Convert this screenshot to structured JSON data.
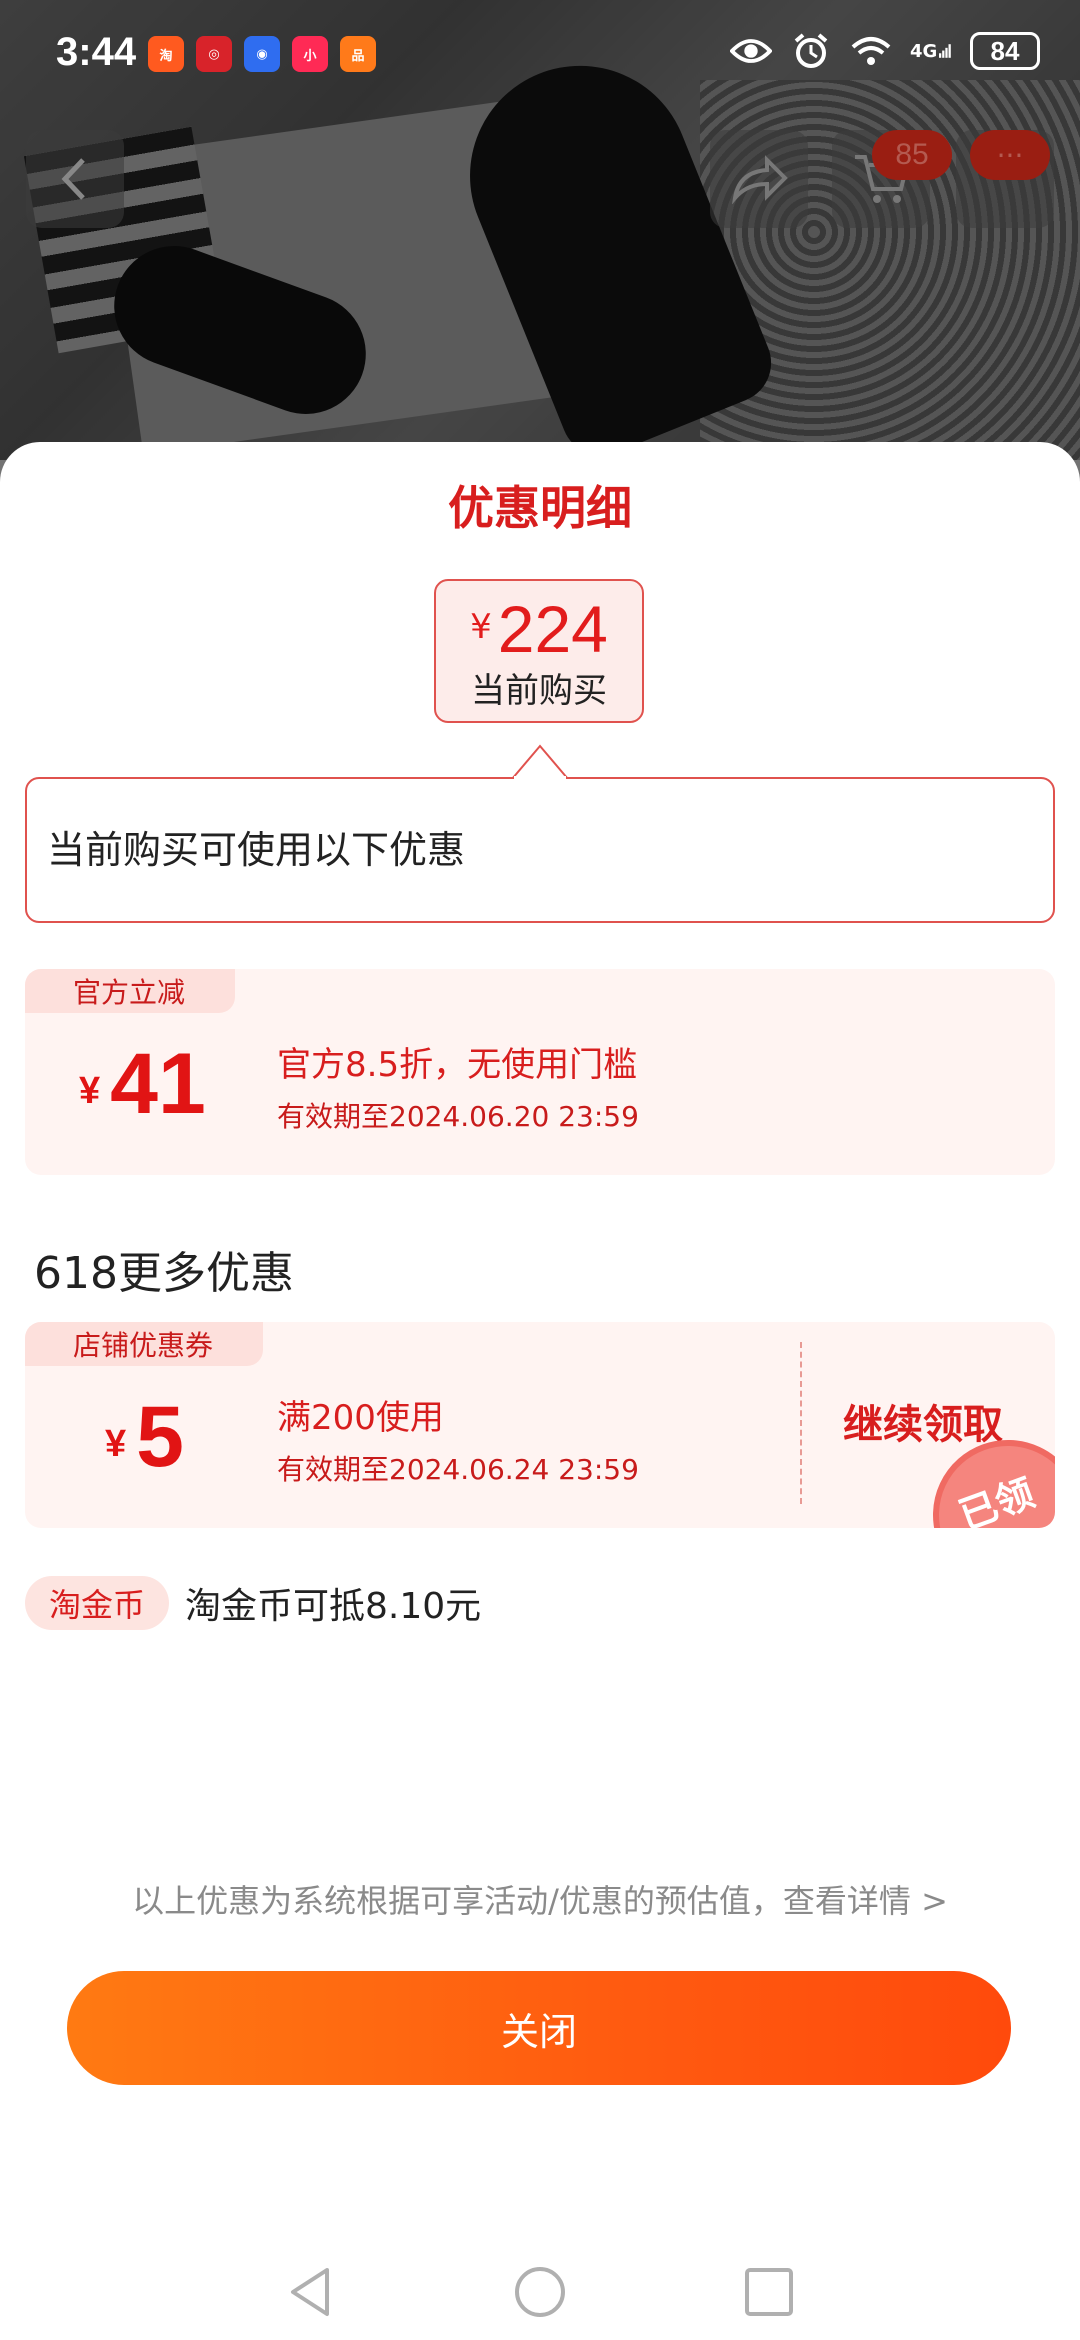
{
  "status_bar": {
    "time": "3:44",
    "app_icons": [
      {
        "label": "淘",
        "color": "#ff5a1f",
        "name": "taobao-app-icon"
      },
      {
        "label": "◎",
        "color": "#d8232a",
        "name": "app-icon-2"
      },
      {
        "label": "◉",
        "color": "#2f6df0",
        "name": "app-icon-3"
      },
      {
        "label": "小",
        "color": "#ff2a55",
        "name": "xiaohongshu-app-icon"
      },
      {
        "label": "品",
        "color": "#ff7a1a",
        "name": "app-icon-5"
      }
    ],
    "network": "4G",
    "battery": "84"
  },
  "top_nav": {
    "cart_count": "85",
    "more_label": "···"
  },
  "sheet": {
    "title": "优惠明细",
    "current_price": {
      "currency": "¥",
      "amount": "224",
      "label": "当前购买"
    },
    "callout_text": "当前购买可使用以下优惠",
    "official_discount": {
      "tag": "官方立减",
      "currency": "¥",
      "amount": "41",
      "title": "官方8.5折，无使用门槛",
      "validity": "有效期至2024.06.20 23:59"
    },
    "more_section_title": "618更多优惠",
    "shop_coupon": {
      "tag": "店铺优惠券",
      "currency": "¥",
      "amount": "5",
      "title": "满200使用",
      "validity": "有效期至2024.06.24 23:59",
      "action_label": "继续领取",
      "stamp_label": "已领"
    },
    "coin": {
      "tag": "淘金币",
      "text": "淘金币可抵8.10元"
    },
    "disclaimer": "以上优惠为系统根据可享活动/优惠的预估值，查看详情 >",
    "close_label": "关闭"
  },
  "colors": {
    "accent": "#d81e1e",
    "button_start": "#ff7a12",
    "button_end": "#ff4a0c"
  }
}
